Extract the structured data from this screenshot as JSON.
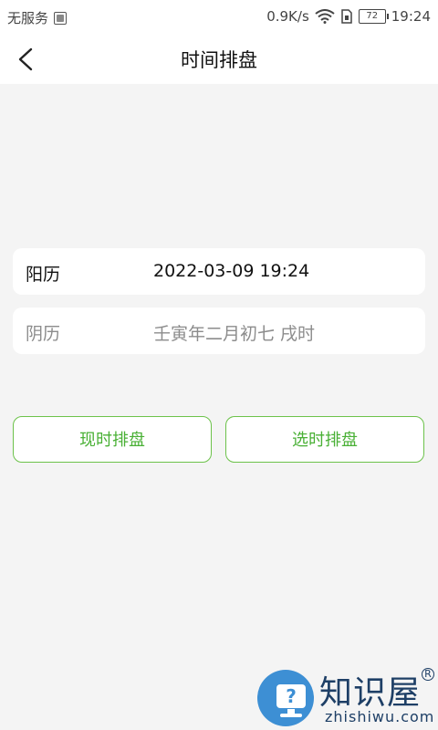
{
  "status_bar": {
    "carrier": "无服务",
    "net_speed": "0.9K/s",
    "battery": "72",
    "time": "19:24",
    "icons": [
      "sim-icon",
      "wifi-icon",
      "data-sim-icon",
      "battery-icon"
    ]
  },
  "header": {
    "back_icon": "chevron-left-icon",
    "title": "时间排盘"
  },
  "date_info": {
    "solar_label": "阳历",
    "solar_value": "2022-03-09 19:24",
    "lunar_label": "阴历",
    "lunar_value": "壬寅年二月初七 戌时"
  },
  "actions": {
    "now_label": "现时排盘",
    "select_label": "选时排盘"
  },
  "watermark": {
    "chinese": "知识屋",
    "english": "zhishiwu.com",
    "reg_mark": "R"
  },
  "colors": {
    "accent_green": "#49b035",
    "button_border": "#6cc24a",
    "background": "#f4f4f4",
    "card": "#ffffff",
    "muted_text": "#8c8c8c"
  }
}
